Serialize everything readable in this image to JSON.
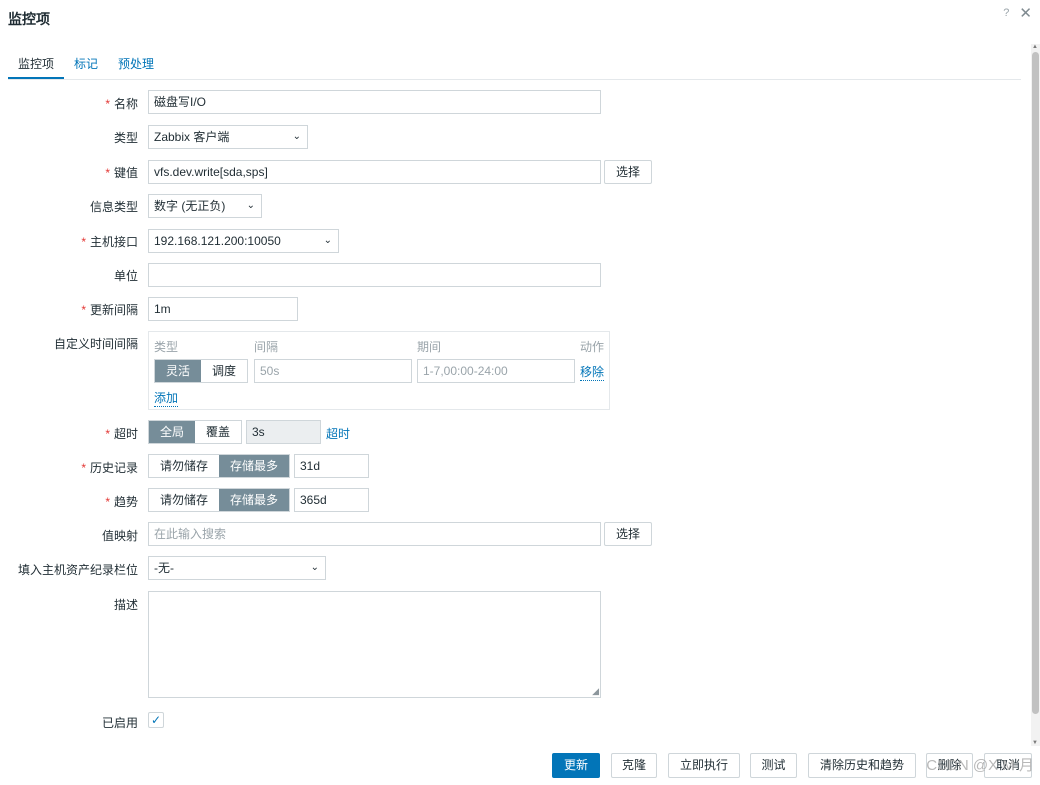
{
  "dialog": {
    "title": "监控项",
    "help": "?",
    "close": "✕"
  },
  "tabs": [
    {
      "label": "监控项"
    },
    {
      "label": "标记"
    },
    {
      "label": "预处理"
    }
  ],
  "form": {
    "name": {
      "label": "名称",
      "value": "磁盘写I/O"
    },
    "type": {
      "label": "类型",
      "value": "Zabbix 客户端"
    },
    "key": {
      "label": "键值",
      "value": "vfs.dev.write[sda,sps]",
      "select_label": "选择"
    },
    "info_type": {
      "label": "信息类型",
      "value": "数字 (无正负)"
    },
    "host_interface": {
      "label": "主机接口",
      "value": "192.168.121.200:10050"
    },
    "units": {
      "label": "单位",
      "value": ""
    },
    "update_interval": {
      "label": "更新间隔",
      "value": "1m"
    },
    "custom_intervals": {
      "label": "自定义时间间隔",
      "col_type": "类型",
      "col_interval": "间隔",
      "col_period": "期间",
      "col_action": "动作",
      "seg_flexible": "灵活",
      "seg_scheduling": "调度",
      "interval_placeholder": "50s",
      "period_placeholder": "1-7,00:00-24:00",
      "remove": "移除",
      "add": "添加"
    },
    "timeout": {
      "label": "超时",
      "seg_global": "全局",
      "seg_override": "覆盖",
      "value": "3s",
      "link": "超时"
    },
    "history": {
      "label": "历史记录",
      "seg_nostore": "请勿储存",
      "seg_store": "存储最多",
      "value": "31d"
    },
    "trends": {
      "label": "趋势",
      "seg_nostore": "请勿储存",
      "seg_store": "存储最多",
      "value": "365d"
    },
    "valuemap": {
      "label": "值映射",
      "placeholder": "在此输入搜索",
      "select_label": "选择"
    },
    "inventory": {
      "label": "填入主机资产纪录栏位",
      "value": "-无-"
    },
    "description": {
      "label": "描述",
      "value": ""
    },
    "enabled": {
      "label": "已启用",
      "checked": true
    }
  },
  "footer": {
    "update": "更新",
    "clone": "克隆",
    "execute": "立即执行",
    "test": "测试",
    "clear": "清除历史和趋势",
    "delete": "删除",
    "cancel": "取消"
  },
  "watermark": "CSDN @X M 月"
}
